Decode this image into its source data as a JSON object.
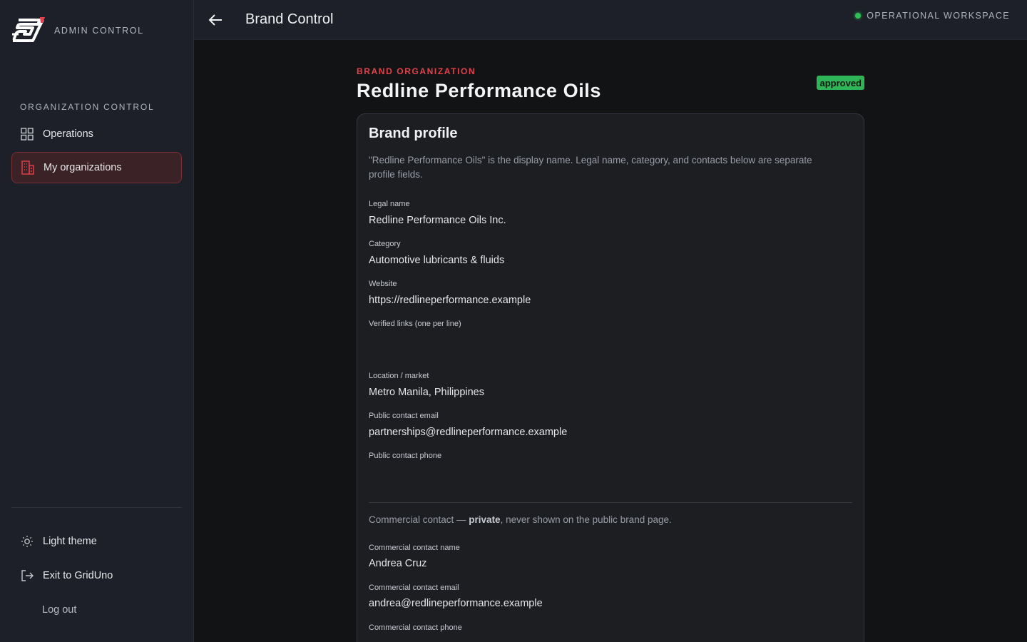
{
  "sidebar": {
    "app_label": "ADMIN CONTROL",
    "section_label": "ORGANIZATION CONTROL",
    "nav": [
      {
        "label": "Operations",
        "icon": "grid-icon"
      },
      {
        "label": "My organizations",
        "icon": "building-icon",
        "active": true
      }
    ],
    "footer": [
      {
        "label": "Light theme",
        "icon": "sun-icon"
      },
      {
        "label": "Exit to GridUno",
        "icon": "exit-icon"
      },
      {
        "label": "Log out"
      }
    ]
  },
  "topbar": {
    "title": "Brand Control",
    "workspace_status": "OPERATIONAL WORKSPACE",
    "status_color": "#2fbf56"
  },
  "org": {
    "eyebrow": "BRAND ORGANIZATION",
    "name": "Redline Performance Oils",
    "status": "approved",
    "accent_color": "#e8404a"
  },
  "profile": {
    "title": "Brand profile",
    "description": "\"Redline Performance Oils\" is the display name. Legal name, category, and contacts below are separate profile fields.",
    "fields": [
      {
        "label": "Legal name",
        "value": "Redline Performance Oils Inc."
      },
      {
        "label": "Category",
        "value": "Automotive lubricants & fluids"
      },
      {
        "label": "Website",
        "value": "https://redlineperformance.example"
      },
      {
        "label": "Verified links (one per line)",
        "value": ""
      },
      {
        "label": "Location / market",
        "value": "Metro Manila, Philippines"
      },
      {
        "label": "Public contact email",
        "value": "partnerships@redlineperformance.example"
      },
      {
        "label": "Public contact phone",
        "value": ""
      }
    ],
    "private_note_prefix": "Commercial contact — ",
    "private_note_bold": "private",
    "private_note_suffix": ", never shown on the public brand page.",
    "commercial_fields": [
      {
        "label": "Commercial contact name",
        "value": "Andrea Cruz"
      },
      {
        "label": "Commercial contact email",
        "value": "andrea@redlineperformance.example"
      },
      {
        "label": "Commercial contact phone",
        "value": ""
      }
    ]
  }
}
